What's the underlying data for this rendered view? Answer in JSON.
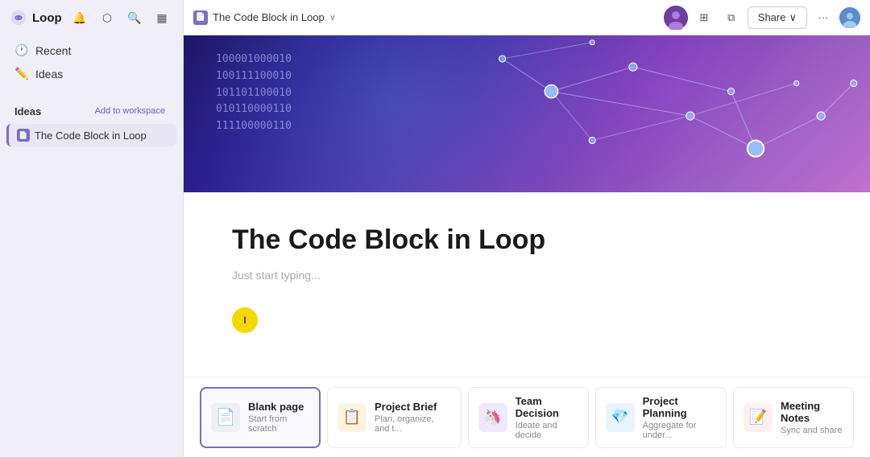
{
  "app": {
    "name": "Loop",
    "logo_text": "Loop"
  },
  "sidebar": {
    "nav_items": [
      {
        "id": "recent",
        "label": "Recent",
        "icon": "🕐"
      },
      {
        "id": "ideas",
        "label": "Ideas",
        "icon": "✏️"
      }
    ],
    "section": {
      "title": "Ideas",
      "add_button_label": "Add to workspace"
    },
    "pages": [
      {
        "id": "code-block-in-loop",
        "label": "The Code Block in Loop",
        "icon": "📄",
        "active": true
      }
    ]
  },
  "topbar": {
    "breadcrumb": {
      "icon": "📄",
      "text": "The Code Block in Loop",
      "chevron": "∨"
    },
    "share_label": "Share",
    "share_chevron": "∨"
  },
  "hero": {
    "binary_lines": [
      "100001000010",
      "100111100010",
      "101101100010",
      "010110000110",
      "111100000110"
    ]
  },
  "page": {
    "title": "The Code Block in Loop",
    "placeholder": "Just start typing...",
    "cursor_label": "I"
  },
  "templates": [
    {
      "id": "blank",
      "name": "Blank page",
      "desc": "Start from scratch",
      "icon": "📄",
      "color": "#f0f0f0",
      "highlighted": true
    },
    {
      "id": "brief",
      "name": "Project Brief",
      "desc": "Plan, organize, and t...",
      "icon": "📋",
      "color": "#fff4e0",
      "highlighted": false
    },
    {
      "id": "decision",
      "name": "Team Decision",
      "desc": "Ideate and decide",
      "icon": "🦄",
      "color": "#f0e8ff",
      "highlighted": false
    },
    {
      "id": "planning",
      "name": "Project Planning",
      "desc": "Aggregate for under...",
      "icon": "💎",
      "color": "#e8f4ff",
      "highlighted": false
    },
    {
      "id": "meeting",
      "name": "Meeting Notes",
      "desc": "Sync and share",
      "icon": "📝",
      "color": "#fff0ee",
      "highlighted": false
    }
  ]
}
